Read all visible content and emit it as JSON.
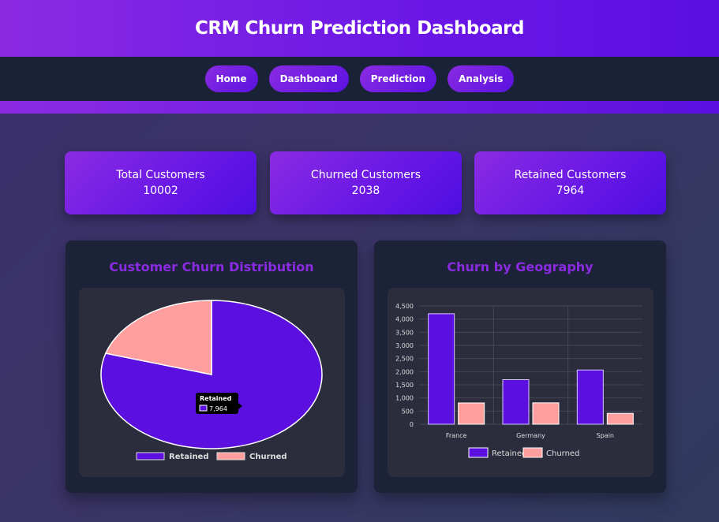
{
  "header": {
    "title": "CRM Churn Prediction Dashboard"
  },
  "nav": {
    "items": [
      {
        "label": "Home"
      },
      {
        "label": "Dashboard"
      },
      {
        "label": "Prediction"
      },
      {
        "label": "Analysis"
      }
    ]
  },
  "stats": [
    {
      "label": "Total Customers",
      "value": "10002"
    },
    {
      "label": "Churned Customers",
      "value": "2038"
    },
    {
      "label": "Retained Customers",
      "value": "7964"
    }
  ],
  "colors": {
    "accent": "#8a2be2",
    "retained": "#5b10e0",
    "churned": "#ff9e9e"
  },
  "chart_data": [
    {
      "type": "pie",
      "title": "Customer Churn Distribution",
      "labels": [
        "Retained",
        "Churned"
      ],
      "values": [
        7964,
        2038
      ],
      "legend": "bottom",
      "tooltip": {
        "title": "Retained",
        "value": "7,964"
      }
    },
    {
      "type": "bar",
      "title": "Churn by Geography",
      "categories": [
        "France",
        "Germany",
        "Spain"
      ],
      "series": [
        {
          "name": "Retained",
          "values": [
            4204,
            1695,
            2064
          ]
        },
        {
          "name": "Churned",
          "values": [
            810,
            814,
            413
          ]
        }
      ],
      "ylim": [
        0,
        4500
      ],
      "yticks": [
        "0",
        "500",
        "1,000",
        "1,500",
        "2,000",
        "2,500",
        "3,000",
        "3,500",
        "4,000",
        "4,500"
      ],
      "legend": "bottom",
      "grid": true
    }
  ]
}
